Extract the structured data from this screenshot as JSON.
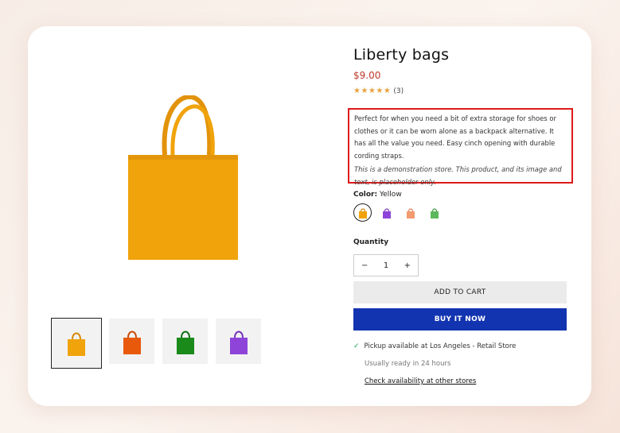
{
  "product": {
    "title": "Liberty bags",
    "price": "$9.00",
    "stars": "★★★★★",
    "rating_count": "(3)",
    "description": "Perfect for when you need a bit of extra storage for shoes or clothes or it can be worn alone as a backpack alternative. It has all the value you need. Easy cinch opening with durable cording straps.",
    "note": "This is a demonstration store. This product, and its image and text, is placeholder only."
  },
  "color": {
    "label": "Color:",
    "selected": "Yellow",
    "swatches": [
      "#f0a30a",
      "#8e44d8",
      "#f39a6e",
      "#5cb85c"
    ]
  },
  "thumbnails": [
    {
      "name": "yellow",
      "color": "#f0a30a"
    },
    {
      "name": "orange",
      "color": "#e8590c"
    },
    {
      "name": "green",
      "color": "#1a8a1a"
    },
    {
      "name": "purple",
      "color": "#8e44d8"
    }
  ],
  "quantity": {
    "label": "Quantity",
    "value": "1",
    "minus": "−",
    "plus": "+"
  },
  "buttons": {
    "add_to_cart": "ADD TO CART",
    "buy_now": "BUY IT NOW"
  },
  "pickup": {
    "check": "✓",
    "text": "Pickup available at Los Angeles - Retail Store",
    "ready": "Usually ready in 24 hours",
    "link": "Check availability at other stores"
  },
  "colors": {
    "price": "#c0392b",
    "buy_button": "#1334b0",
    "highlight_border": "#e01a1a",
    "bag": "#f0a30a"
  }
}
